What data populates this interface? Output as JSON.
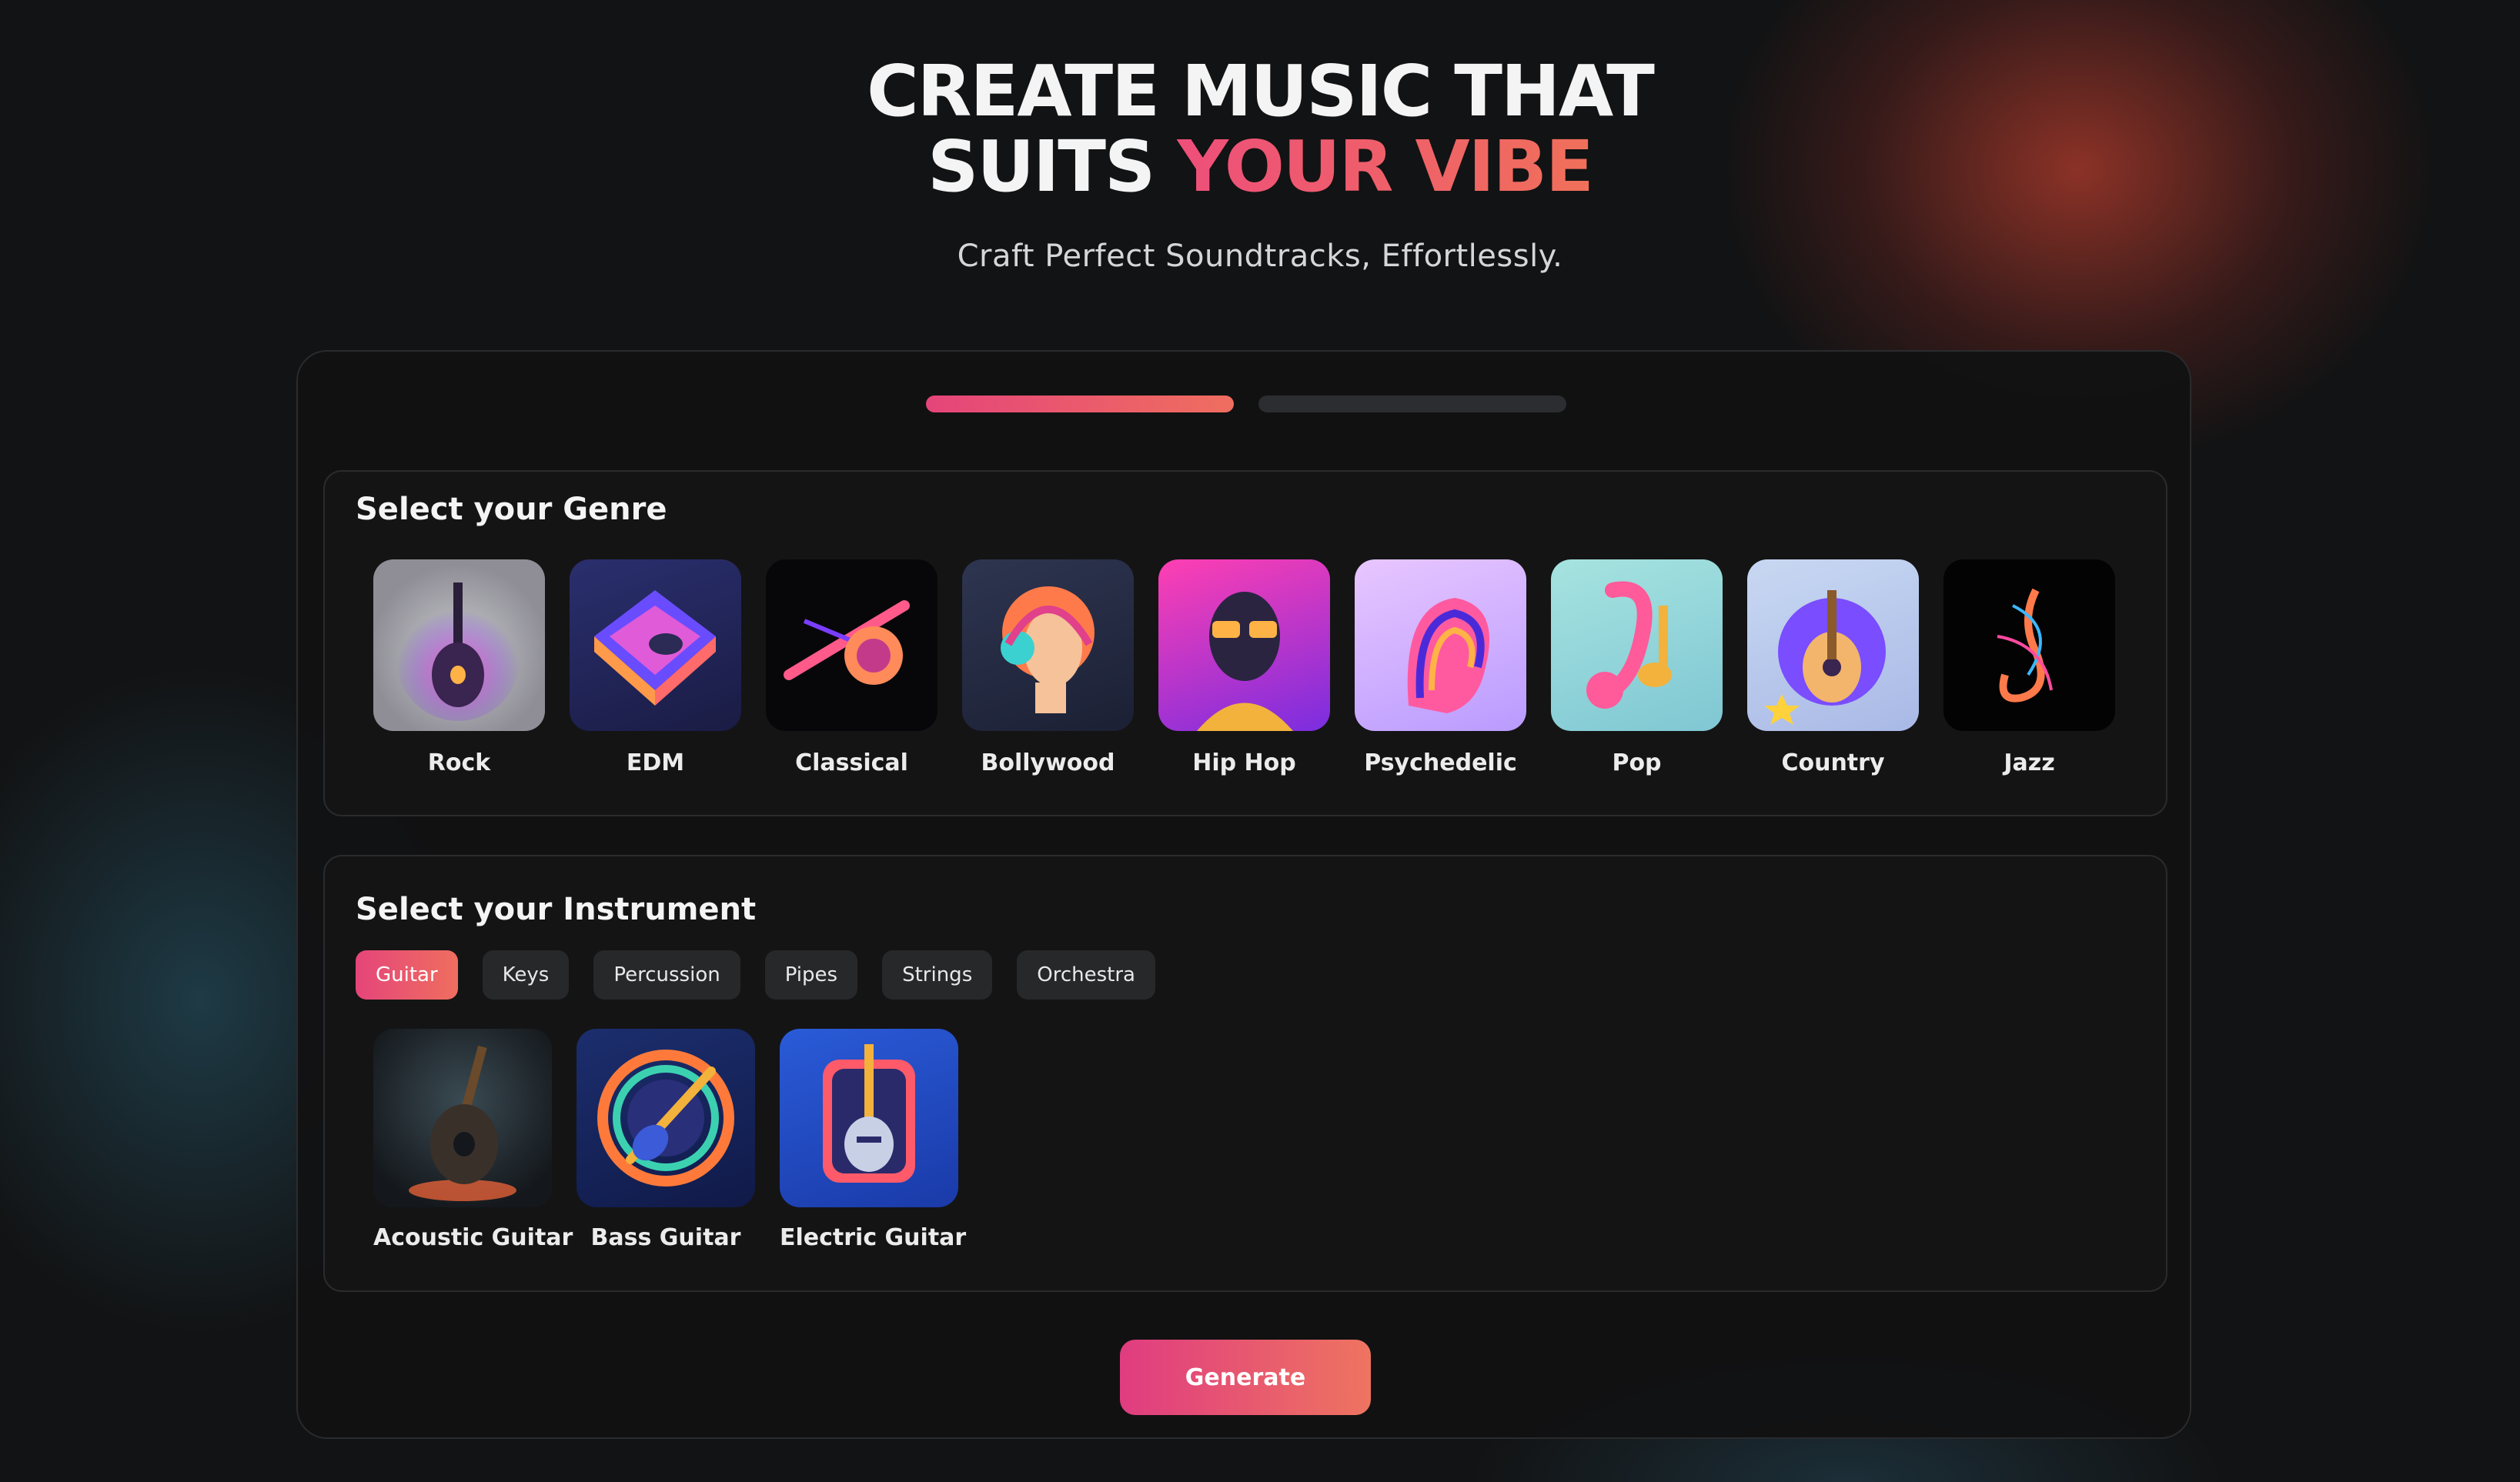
{
  "hero": {
    "title_line1": "CREATE MUSIC THAT",
    "title_line2_plain": "SUITS ",
    "title_line2_accent": "YOUR VIBE",
    "subtitle": "Craft Perfect Soundtracks, Effortlessly."
  },
  "progress": {
    "steps_total": 2,
    "current_step": 1
  },
  "genre": {
    "title": "Select your Genre",
    "items": [
      {
        "label": "Rock",
        "icon": "rock-guitar-icon"
      },
      {
        "label": "EDM",
        "icon": "edm-turntable-icon"
      },
      {
        "label": "Classical",
        "icon": "classical-violin-icon"
      },
      {
        "label": "Bollywood",
        "icon": "bollywood-headphones-icon"
      },
      {
        "label": "Hip Hop",
        "icon": "hiphop-sunglasses-icon"
      },
      {
        "label": "Psychedelic",
        "icon": "psychedelic-head-icon"
      },
      {
        "label": "Pop",
        "icon": "pop-music-note-icon"
      },
      {
        "label": "Country",
        "icon": "country-guitar-icon"
      },
      {
        "label": "Jazz",
        "icon": "jazz-saxophone-icon"
      }
    ]
  },
  "instrument": {
    "title": "Select your Instrument",
    "categories": [
      "Guitar",
      "Keys",
      "Percussion",
      "Pipes",
      "Strings",
      "Orchestra"
    ],
    "selected_category": "Guitar",
    "items": [
      {
        "label": "Acoustic Guitar",
        "icon": "acoustic-guitar-icon"
      },
      {
        "label": "Bass Guitar",
        "icon": "bass-guitar-icon"
      },
      {
        "label": "Electric Guitar",
        "icon": "electric-guitar-icon"
      }
    ]
  },
  "actions": {
    "generate_label": "Generate"
  },
  "colors": {
    "accent_start": "#e5457a",
    "accent_end": "#ef6e5f",
    "background": "#121314"
  }
}
